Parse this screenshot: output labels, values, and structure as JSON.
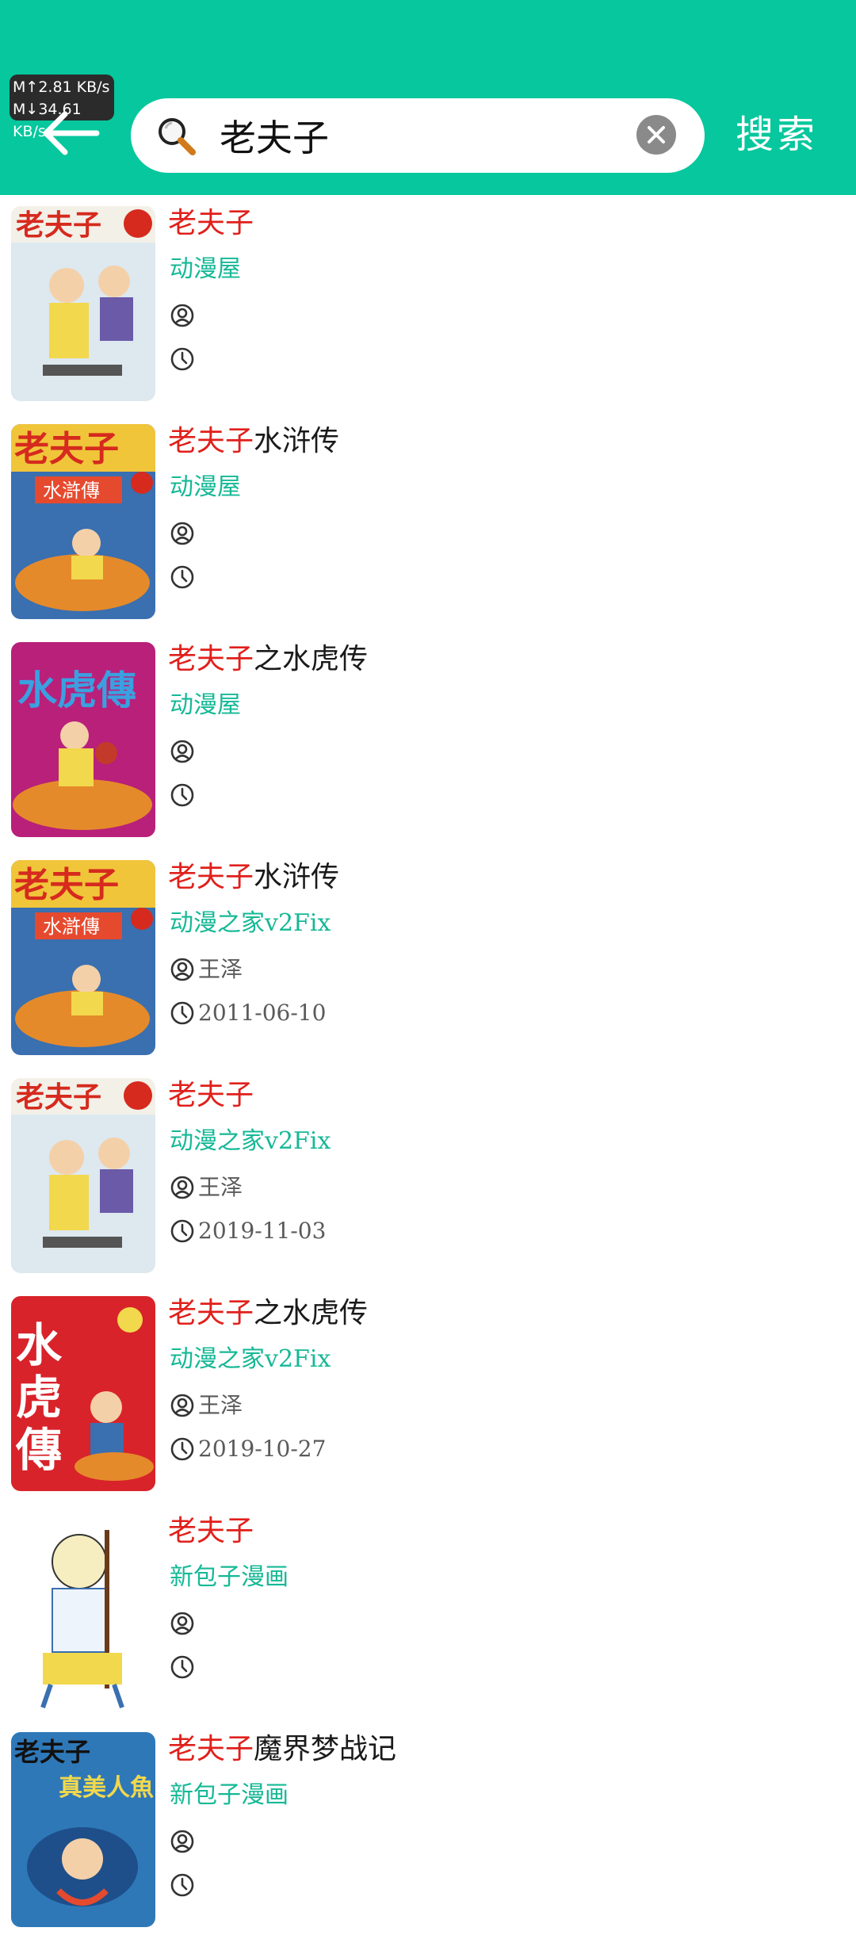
{
  "status": {
    "upload_speed": "M↑2.81 KB/s",
    "download_speed": "M↓34.61 KB/s"
  },
  "search": {
    "query": "老夫子",
    "search_label": "搜索"
  },
  "colors": {
    "header": "#06c79d",
    "keyword_highlight": "#e0201b",
    "source_text": "#16b896"
  },
  "results": [
    {
      "title_highlight": "老夫子",
      "title_rest": "",
      "source": "动漫屋",
      "author": "",
      "date": ""
    },
    {
      "title_highlight": "老夫子",
      "title_rest": "水浒传",
      "source": "动漫屋",
      "author": "",
      "date": ""
    },
    {
      "title_highlight": "老夫子",
      "title_rest": "之水虎传",
      "source": "动漫屋",
      "author": "",
      "date": ""
    },
    {
      "title_highlight": "老夫子",
      "title_rest": "水浒传",
      "source": "动漫之家v2Fix",
      "author": "王泽",
      "date": "2011-06-10"
    },
    {
      "title_highlight": "老夫子",
      "title_rest": "",
      "source": "动漫之家v2Fix",
      "author": "王泽",
      "date": "2019-11-03"
    },
    {
      "title_highlight": "老夫子",
      "title_rest": "之水虎传",
      "source": "动漫之家v2Fix",
      "author": "王泽",
      "date": "2019-10-27"
    },
    {
      "title_highlight": "老夫子",
      "title_rest": "",
      "source": "新包子漫画",
      "author": "",
      "date": ""
    },
    {
      "title_highlight": "老夫子",
      "title_rest": "魔界梦战记",
      "source": "新包子漫画",
      "author": "",
      "date": ""
    }
  ]
}
